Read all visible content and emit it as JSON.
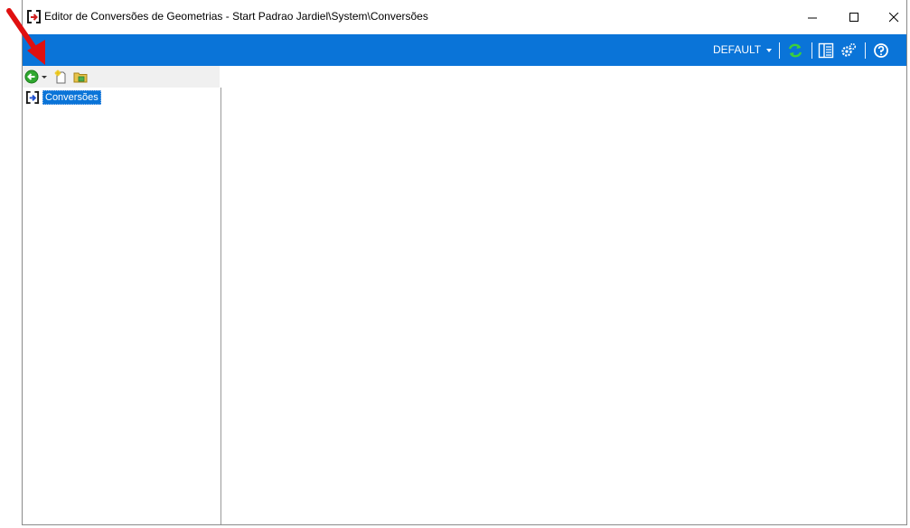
{
  "window": {
    "title": "Editor de Conversões de Geometrias - Start Padrao Jardiel\\System\\Conversões",
    "controls": {
      "minimize": "minimize-icon",
      "maximize": "maximize-icon",
      "close": "close-icon"
    }
  },
  "ribbon": {
    "profile_label": "DEFAULT",
    "accent": "#0a74d8",
    "icons": [
      "refresh-icon",
      "layout-icon",
      "settings-icon",
      "help-icon"
    ]
  },
  "toolbar": {
    "icons": [
      "back-icon",
      "dropdown-icon",
      "new-item-icon",
      "open-folder-icon"
    ]
  },
  "tree": {
    "items": [
      {
        "label": "Conversões",
        "selected": true
      }
    ]
  },
  "annotation": {
    "color": "#e01010",
    "icon": "red-arrow-annotation"
  }
}
